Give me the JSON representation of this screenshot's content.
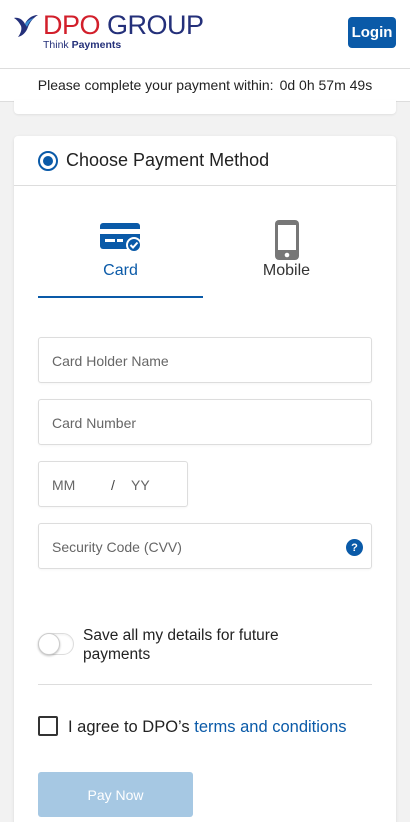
{
  "header": {
    "logo_brand_dpo": "DPO",
    "logo_brand_group": " GROUP",
    "logo_tagline_think": "Think ",
    "logo_tagline_payments": "Payments",
    "login_label": "Login"
  },
  "timer": {
    "label": "Please complete your payment within:",
    "value": "0d 0h 57m 49s"
  },
  "payment": {
    "title": "Choose Payment Method",
    "tabs": [
      {
        "label": "Card",
        "icon": "credit-card-icon",
        "active": true
      },
      {
        "label": "Mobile",
        "icon": "mobile-phone-icon",
        "active": false
      }
    ],
    "fields": {
      "card_holder_placeholder": "Card Holder Name",
      "card_number_placeholder": "Card Number",
      "month_placeholder": "MM",
      "expiry_separator": "/",
      "year_placeholder": "YY",
      "cvv_placeholder": "Security Code (CVV)",
      "cvv_help": "?"
    },
    "save_details_label": "Save all my details for future payments",
    "agree_prefix": "I agree to DPO’s ",
    "agree_link": "terms and conditions",
    "pay_label": "Pay Now"
  },
  "colors": {
    "accent": "#0a5aa8",
    "brand_red": "#d21f2b",
    "brand_navy": "#24307a",
    "pay_disabled": "#a6c8e3"
  }
}
